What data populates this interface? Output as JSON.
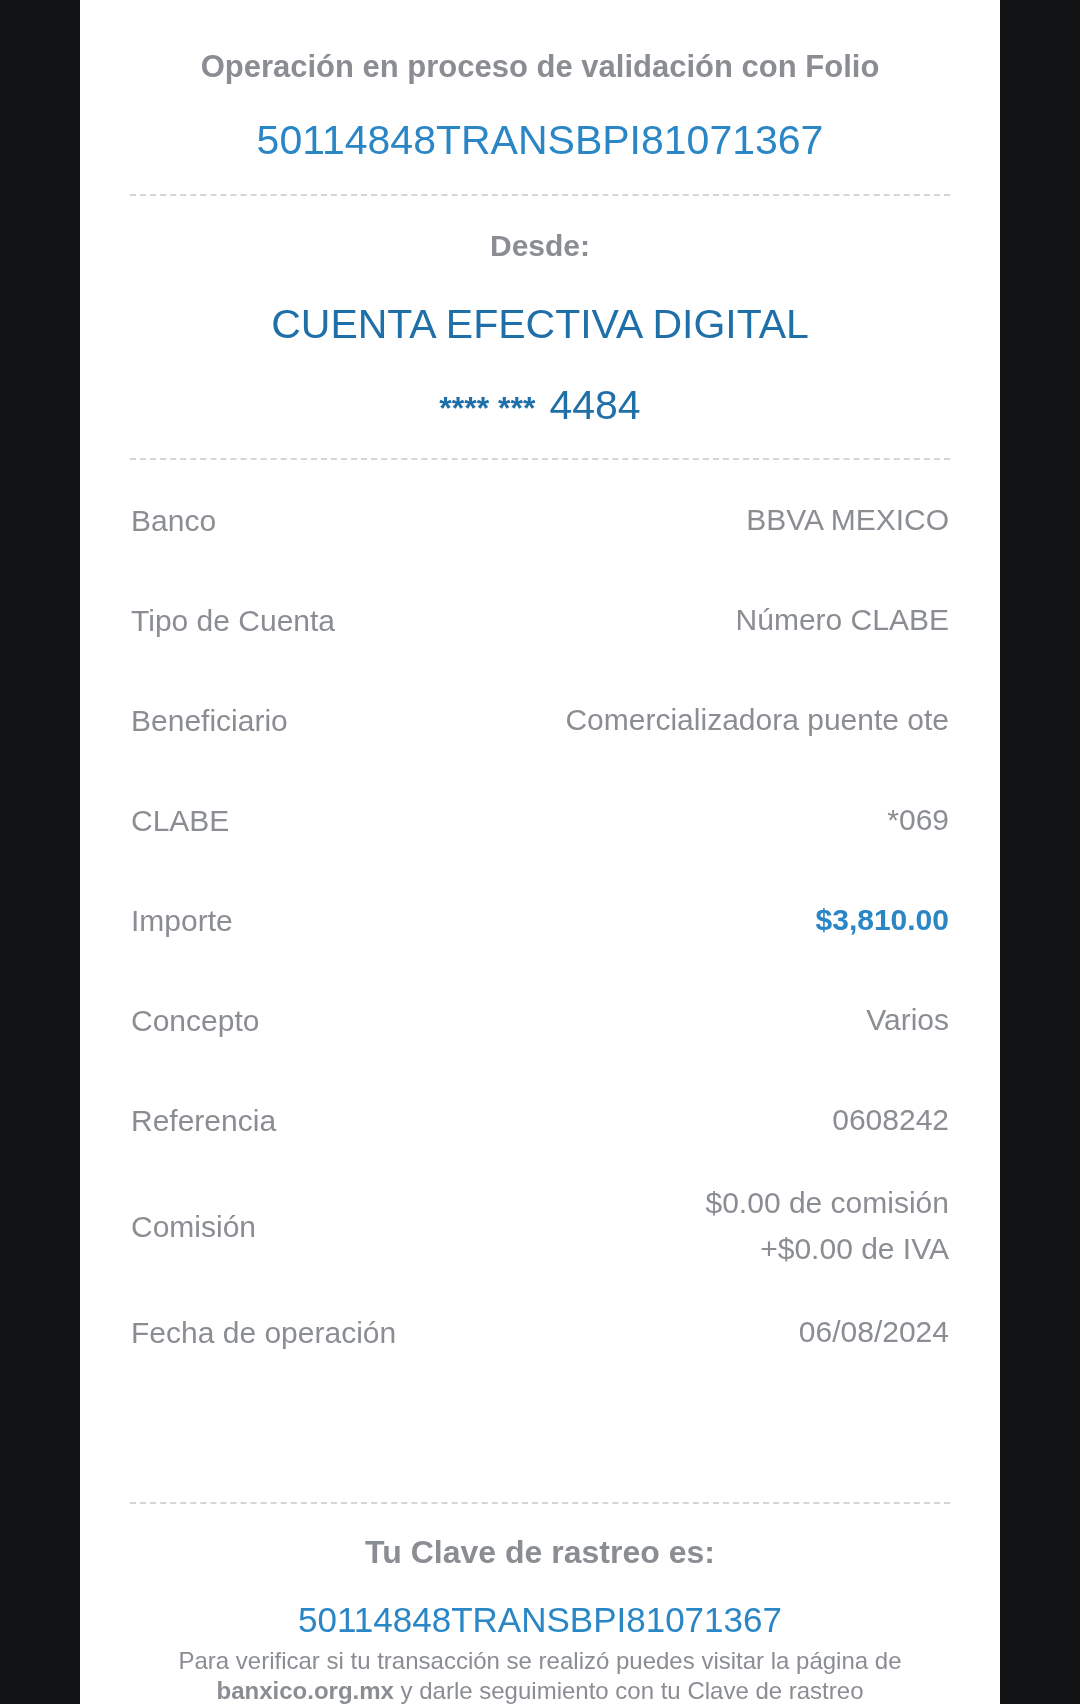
{
  "header": {
    "title": "Operación en proceso de validación con Folio",
    "folio": "50114848TRANSBPI81071367"
  },
  "origin": {
    "label": "Desde:",
    "account_name": "CUENTA EFECTIVA DIGITAL",
    "account_mask": "**** ***",
    "account_last": "4484"
  },
  "details": [
    {
      "label": "Banco",
      "value": [
        "BBVA MEXICO"
      ],
      "kind": "text"
    },
    {
      "label": "Tipo de Cuenta",
      "value": [
        "Número CLABE"
      ],
      "kind": "text"
    },
    {
      "label": "Beneficiario",
      "value": [
        "Comercializadora puente ote"
      ],
      "kind": "text"
    },
    {
      "label": "CLABE",
      "value": [
        "*069"
      ],
      "kind": "text"
    },
    {
      "label": "Importe",
      "value": [
        "$3,810.00"
      ],
      "kind": "amount"
    },
    {
      "label": "Concepto",
      "value": [
        "Varios"
      ],
      "kind": "text"
    },
    {
      "label": "Referencia",
      "value": [
        "0608242"
      ],
      "kind": "text"
    },
    {
      "label": "Comisión",
      "value": [
        "$0.00 de comisión",
        "+$0.00 de IVA"
      ],
      "kind": "text"
    },
    {
      "label": "Fecha de operación",
      "value": [
        "06/08/2024"
      ],
      "kind": "text"
    }
  ],
  "tracking": {
    "title": "Tu Clave de rastreo es:",
    "code": "50114848TRANSBPI81071367",
    "note": "Para verificar si tu transacción se realizó puedes visitar la página de **banxico.org.mx** y darle seguimiento con tu Clave de rastreo"
  }
}
